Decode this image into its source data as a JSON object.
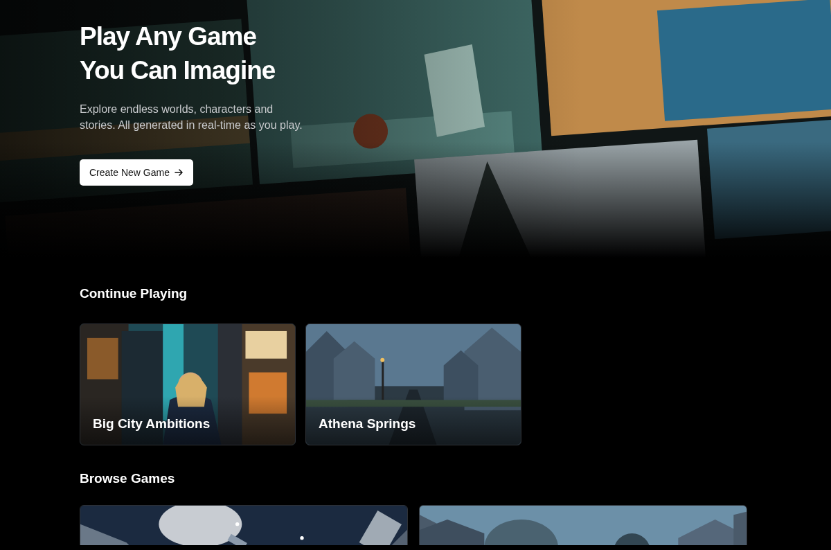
{
  "hero": {
    "title_lines": [
      "Play Any Game",
      "You Can Imagine"
    ],
    "subtitle": "Explore endless worlds, characters and stories. All generated in real-time as you play.",
    "button": {
      "label": "Create New Game"
    }
  },
  "continue_playing": {
    "heading": "Continue Playing",
    "games": [
      {
        "title": "Big City Ambitions",
        "kind": "picture"
      },
      {
        "title": "Athena Springs",
        "kind": "picture"
      }
    ]
  },
  "browse_games": {
    "heading": "Browse Games"
  }
}
